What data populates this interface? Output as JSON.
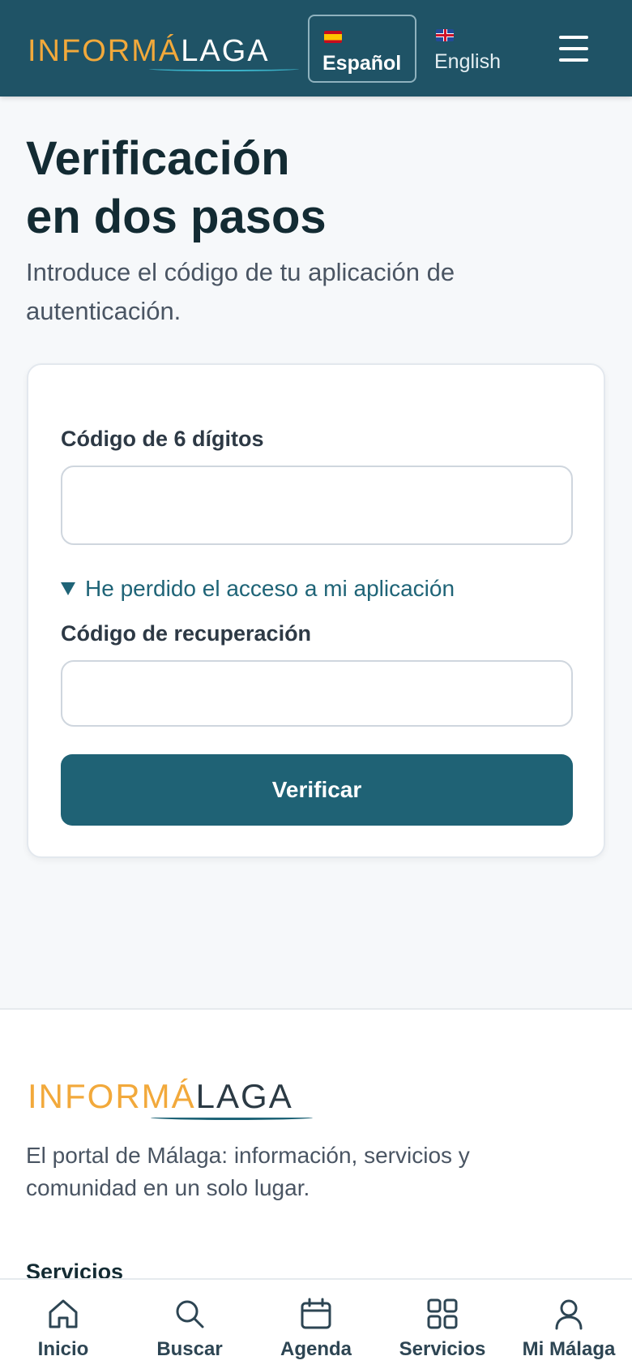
{
  "header": {
    "logo_part1": "INFORMÁ",
    "logo_part2": "LAGA",
    "lang_es_label": "Español",
    "lang_en_label": "English"
  },
  "main": {
    "title_line1": "Verificación",
    "title_line2": "en dos pasos",
    "subtitle": "Introduce el código de tu aplicación de autenticación."
  },
  "form": {
    "code_label": "Código de 6 dígitos",
    "code_value": "",
    "lost_access_label": "He perdido el acceso a mi aplicación",
    "recovery_label": "Código de recuperación",
    "recovery_value": "",
    "verify_button": "Verificar"
  },
  "footer": {
    "logo_part1": "INFORMÁ",
    "logo_part2": "LAGA",
    "description": "El portal de Málaga: información, servicios y comunidad en un solo lugar.",
    "section_heading": "Servicios"
  },
  "bottom_nav": {
    "items": [
      {
        "label": "Inicio",
        "icon": "home-icon"
      },
      {
        "label": "Buscar",
        "icon": "search-icon"
      },
      {
        "label": "Agenda",
        "icon": "calendar-icon"
      },
      {
        "label": "Servicios",
        "icon": "grid-icon"
      },
      {
        "label": "Mi Málaga",
        "icon": "user-icon"
      }
    ]
  },
  "colors": {
    "primary": "#1f5366",
    "button": "#1f6275",
    "accent_orange": "#f2a93b"
  }
}
